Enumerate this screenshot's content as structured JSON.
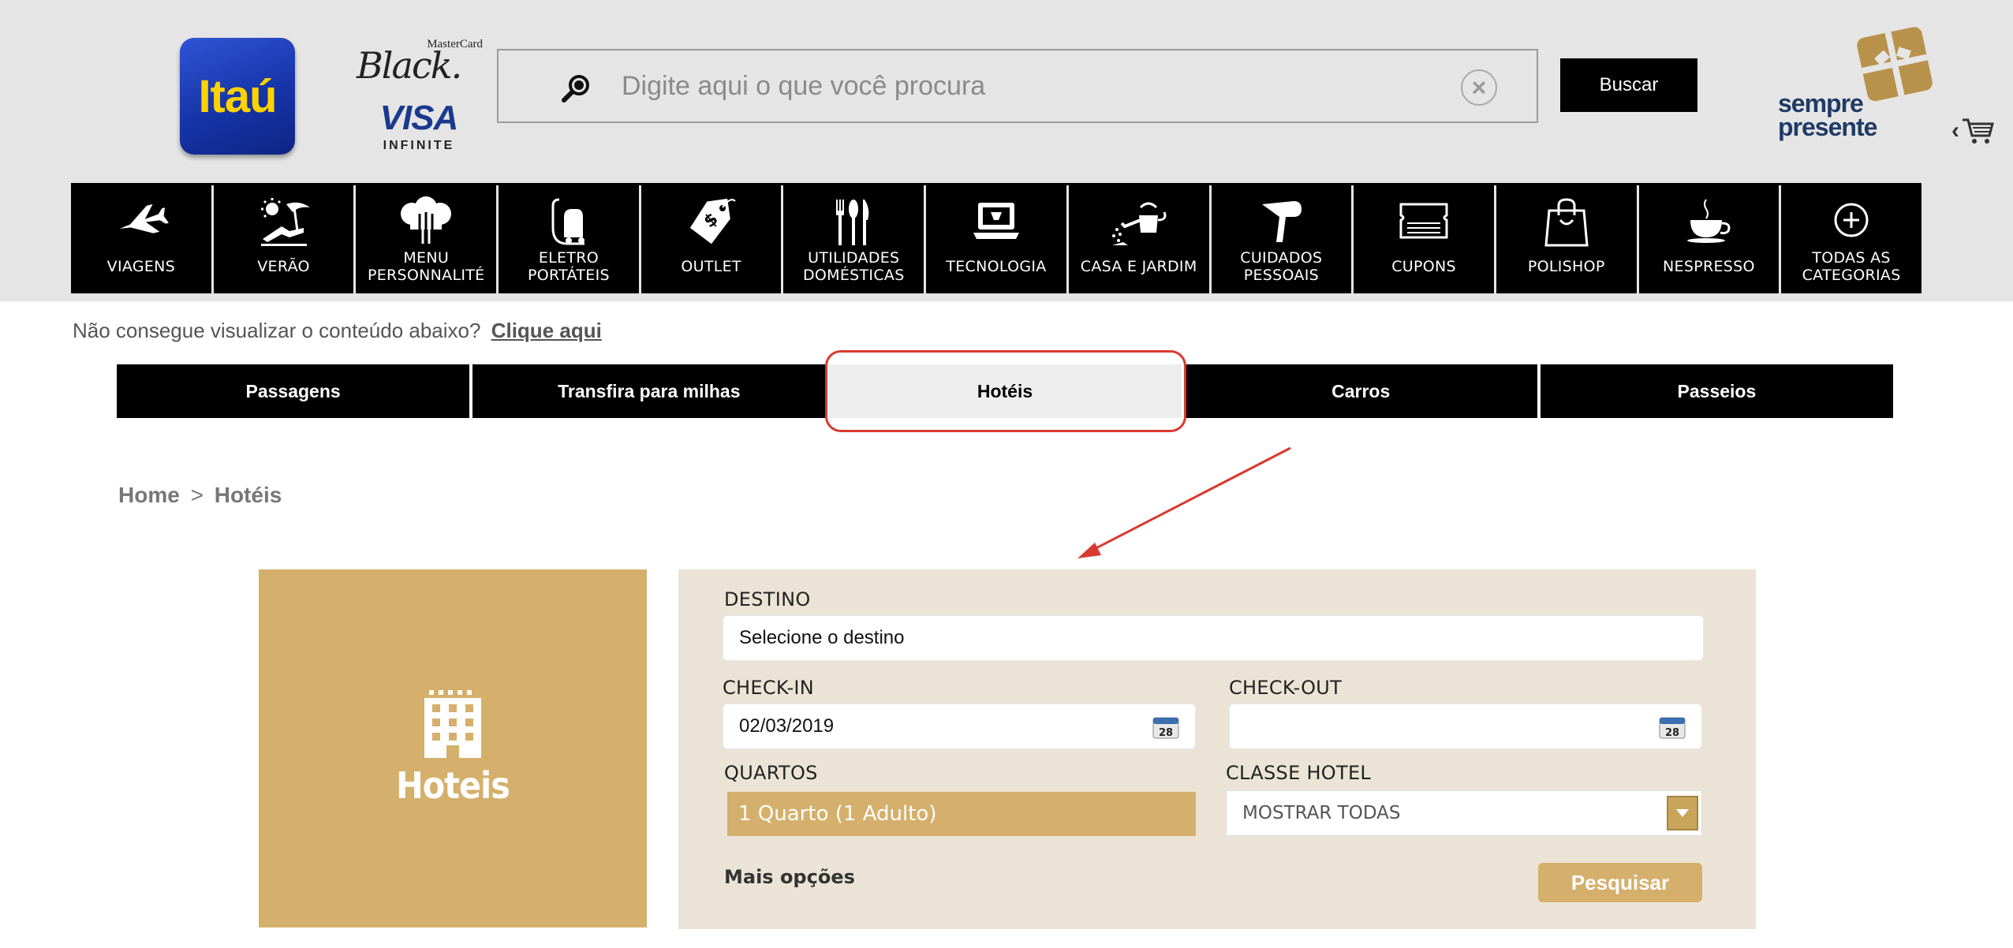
{
  "header": {
    "itau_logo_text": "Itaú",
    "mastercard_top": "MasterCard",
    "mastercard_script": "Black.",
    "visa_word": "VISA",
    "visa_sub": "INFINITE",
    "search_placeholder": "Digite aqui o que você procura",
    "search_button": "Buscar",
    "sempre_presente_line1": "sempre",
    "sempre_presente_line2": "presente"
  },
  "categories": [
    {
      "label": "VIAGENS",
      "icon": "airplane-icon"
    },
    {
      "label": "VERÃO",
      "icon": "beach-chair-icon"
    },
    {
      "label": "MENU PERSONNALITÉ",
      "icon": "chef-hat-icon"
    },
    {
      "label": "ELETRO PORTÁTEIS",
      "icon": "vacuum-icon"
    },
    {
      "label": "OUTLET",
      "icon": "price-tag-icon"
    },
    {
      "label": "UTILIDADES DOMÉSTICAS",
      "icon": "cutlery-icon"
    },
    {
      "label": "TECNOLOGIA",
      "icon": "laptop-icon"
    },
    {
      "label": "CASA E JARDIM",
      "icon": "watering-can-icon"
    },
    {
      "label": "CUIDADOS PESSOAIS",
      "icon": "hair-dryer-icon"
    },
    {
      "label": "CUPONS",
      "icon": "coupon-icon"
    },
    {
      "label": "POLISHOP",
      "icon": "shopping-bag-icon"
    },
    {
      "label": "NESPRESSO",
      "icon": "coffee-cup-icon"
    },
    {
      "label": "TODAS AS CATEGORIAS",
      "icon": "plus-circle-icon"
    }
  ],
  "notice": {
    "text": "Não consegue visualizar o conteúdo abaixo?",
    "link": "Clique aqui"
  },
  "tabs": [
    {
      "label": "Passagens",
      "active": false
    },
    {
      "label": "Transfira para milhas",
      "active": false
    },
    {
      "label": "Hotéis",
      "active": true
    },
    {
      "label": "Carros",
      "active": false
    },
    {
      "label": "Passeios",
      "active": false
    }
  ],
  "breadcrumb": {
    "home": "Home",
    "separator": ">",
    "current": "Hotéis"
  },
  "hotel_tile": {
    "label": "Hoteis",
    "icon": "hotel-building-icon"
  },
  "form": {
    "destino_label": "DESTINO",
    "destino_value": "Selecione o destino",
    "checkin_label": "CHECK-IN",
    "checkin_value": "02/03/2019",
    "checkout_label": "CHECK-OUT",
    "checkout_value": "",
    "calendar_day": "28",
    "quartos_label": "QUARTOS",
    "quartos_value": "1 Quarto (1 Adulto)",
    "classe_label": "CLASSE HOTEL",
    "classe_value": "MOSTRAR TODAS",
    "mais_opcoes": "Mais opções",
    "pesquisar": "Pesquisar"
  },
  "colors": {
    "gold": "#d4b06c",
    "panel_bg": "#ebe3d5",
    "header_bg": "#e5e5e5",
    "highlight_red": "#d93a2f"
  }
}
